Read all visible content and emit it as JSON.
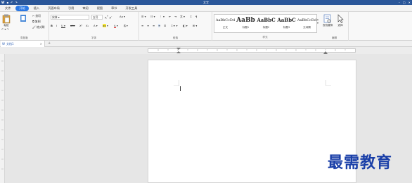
{
  "titlebar": {
    "app_label": "W",
    "title": "文字"
  },
  "tabs": [
    {
      "label": "文件"
    },
    {
      "label": "开始"
    },
    {
      "label": "插入"
    },
    {
      "label": "页面布局"
    },
    {
      "label": "引用"
    },
    {
      "label": "审阅"
    },
    {
      "label": "视图"
    },
    {
      "label": "章节"
    },
    {
      "label": "开发工具"
    }
  ],
  "ribbon": {
    "clipboard": {
      "paste": "粘贴",
      "cut": "剪切",
      "copy": "复制",
      "format_painter": "格式刷",
      "group_label": "剪贴板"
    },
    "font": {
      "font_name": "宋体",
      "font_size": "五号",
      "group_label": "字体"
    },
    "paragraph": {
      "group_label": "段落"
    },
    "styles": {
      "items": [
        {
          "sample": "AaBbCcDd",
          "name": "正文"
        },
        {
          "sample": "AaBb",
          "name": "标题1"
        },
        {
          "sample": "AaBbC",
          "name": "标题2"
        },
        {
          "sample": "AaBbC",
          "name": "标题3"
        },
        {
          "sample": "AaBbCcDd",
          "name": "无间隔"
        }
      ],
      "group_label": "样式"
    },
    "editing": {
      "find_replace": "查找替换",
      "select": "选择",
      "group_label": "编辑"
    }
  },
  "doctab": {
    "name": "文档1"
  },
  "watermark": "最需教育"
}
